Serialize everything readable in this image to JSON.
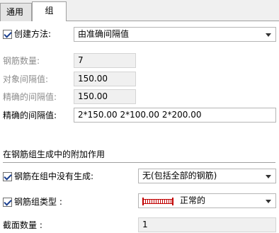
{
  "tabs": [
    {
      "label": "通用性"
    },
    {
      "label": "组"
    }
  ],
  "creation_method": {
    "checked": true,
    "label": "创建方法:",
    "value": "由准确间隔值"
  },
  "rebar_count": {
    "label": "钢筋数量:",
    "value": "7"
  },
  "target_spacing": {
    "label": "对象间隔值:",
    "value": "150.00"
  },
  "exact_spacing_ro": {
    "label": "精确的间隔值:",
    "value": "150.00"
  },
  "exact_spacing": {
    "label": "精确的间隔值:",
    "value": "2*150.00 2*100.00 2*200.00"
  },
  "section": {
    "title": "在钢筋组生成中的附加作用"
  },
  "not_generated": {
    "checked": true,
    "label": "钢筋在组中没有生成:",
    "value": "无(包括全部的钢筋)"
  },
  "group_type": {
    "checked": true,
    "label": "钢筋组类型 :",
    "value": "正常的",
    "swatch_color": "#c00000"
  },
  "section_count": {
    "label": "截面数量 :",
    "value": "1"
  }
}
